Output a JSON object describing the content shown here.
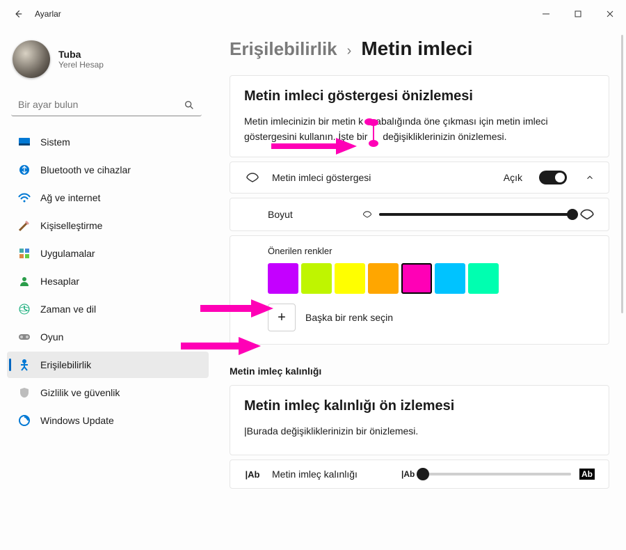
{
  "titlebar": {
    "app_name": "Ayarlar"
  },
  "user": {
    "name": "Tuba",
    "sub": "Yerel Hesap"
  },
  "search": {
    "placeholder": "Bir ayar bulun"
  },
  "sidebar": {
    "items": [
      {
        "label": "Sistem"
      },
      {
        "label": "Bluetooth ve cihazlar"
      },
      {
        "label": "Ağ ve internet"
      },
      {
        "label": "Kişiselleştirme"
      },
      {
        "label": "Uygulamalar"
      },
      {
        "label": "Hesaplar"
      },
      {
        "label": "Zaman ve dil"
      },
      {
        "label": "Oyun"
      },
      {
        "label": "Erişilebilirlik"
      },
      {
        "label": "Gizlilik ve güvenlik"
      },
      {
        "label": "Windows Update"
      }
    ],
    "active_index": 8
  },
  "breadcrumb": {
    "root": "Erişilebilirlik",
    "leaf": "Metin imleci"
  },
  "preview_card": {
    "title": "Metin imleci göstergesi önizlemesi",
    "desc_part1": "Metin imlecinizin bir metin k",
    "desc_part2": "abalığında öne çıkması için metin imleci göstergesini kullanın.",
    "desc_part3": " İşte bir",
    "desc_part4": " değişikliklerinizin önizlemesi."
  },
  "indicator_row": {
    "label": "Metin imleci göstergesi",
    "state_label": "Açık"
  },
  "size_row": {
    "label": "Boyut"
  },
  "colors": {
    "title": "Önerilen renkler",
    "swatches": [
      "#c400ff",
      "#bff500",
      "#ffff00",
      "#ffa600",
      "#ff00b6",
      "#00c3ff",
      "#00ffb0"
    ],
    "selected_index": 4,
    "add_label": "Başka bir renk seçin"
  },
  "thickness_section": {
    "heading": "Metin imleç kalınlığı",
    "card_title": "Metin imleç kalınlığı ön izlemesi",
    "card_desc": "Burada değişikliklerinizin bir önizlemesi.",
    "row_label": "Metin imleç kalınlığı",
    "small_glyph": "|Ab",
    "big_glyph": "Ab"
  },
  "annotation_color": "#ff00b6"
}
